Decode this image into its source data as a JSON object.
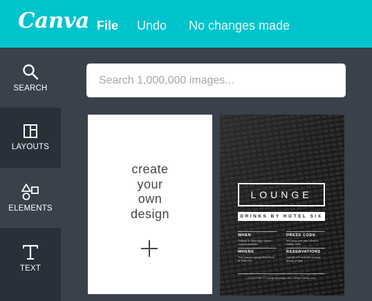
{
  "app": {
    "logo": "Canva"
  },
  "topnav": {
    "file": "File",
    "undo": "Undo",
    "status": "No changes made"
  },
  "sidebar": {
    "items": [
      {
        "label": "SEARCH",
        "icon": "search-icon",
        "active": true
      },
      {
        "label": "LAYOUTS",
        "icon": "layouts-icon",
        "active": false
      },
      {
        "label": "ELEMENTS",
        "icon": "elements-icon",
        "active": true
      },
      {
        "label": "TEXT",
        "icon": "text-icon",
        "active": false
      }
    ]
  },
  "search": {
    "placeholder": "Search 1,000,000 images..."
  },
  "create_card": {
    "line1": "create",
    "line2": "your",
    "line3": "own",
    "line4": "design"
  },
  "template": {
    "title": "LOUNGE",
    "subtitle": "DRINKS BY HOTEL SIX",
    "when_heading": "WHEN",
    "when_text": "Fridays & Saturdays Seven o'clock onwards",
    "dress_heading": "DRESS CODE",
    "dress_text": "We have one rule: Keep it classy, folks.",
    "where_heading": "WHERE",
    "where_text": "The Canva Lounge 55th Floor of Hotel Six",
    "reservations_heading": "RESERVATIONS",
    "reservations_text": "Call 95 677 and talk to book ahead of time",
    "footer": "(07) 123 456 77 | lounge@hotelsix.com | lounge.hotelsix.com"
  },
  "colors": {
    "topbar": "#00c4cc",
    "sidebar": "#293039",
    "panel": "#3a414b"
  }
}
